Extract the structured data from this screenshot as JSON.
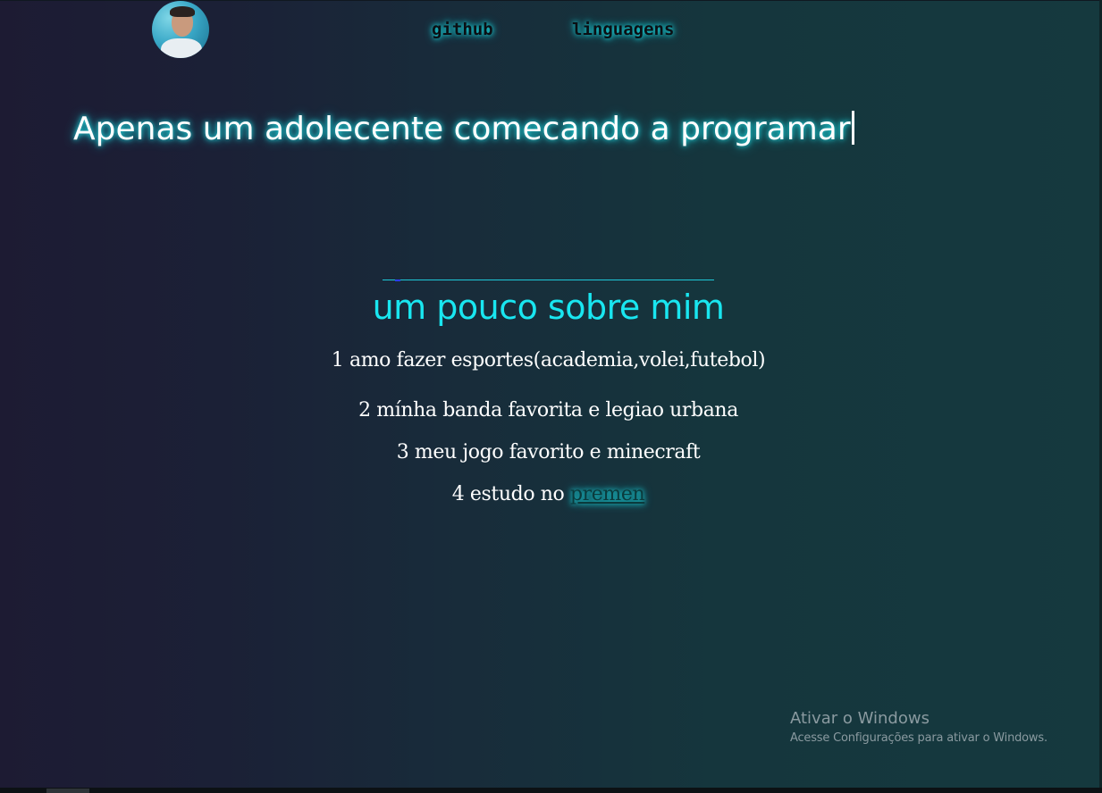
{
  "header": {
    "avatar_alt": "profile photo",
    "nav": [
      {
        "label": "github"
      },
      {
        "label": "linguagens"
      }
    ]
  },
  "hero": {
    "text": "Apenas um adolecente comecando a programar"
  },
  "about": {
    "title": "um pouco sobre mim",
    "items": [
      {
        "text": "1 amo fazer esportes(academia,volei,futebol)"
      },
      {
        "text": "2 mínha banda favorita e legiao urbana"
      },
      {
        "text": "3 meu jogo favorito e minecraft"
      },
      {
        "text": "4 estudo no ",
        "link": "premen"
      }
    ]
  },
  "watermark": {
    "title": "Ativar o Windows",
    "subtitle": "Acesse Configurações para ativar o Windows."
  },
  "colors": {
    "background_left": "#1d1b33",
    "background_right": "#15393e",
    "accent_cyan": "#19e6f0",
    "glow": "#1de0e6",
    "text": "#ffffff"
  }
}
